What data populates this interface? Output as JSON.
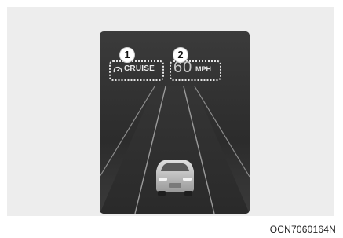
{
  "hud": {
    "cruise": {
      "icon": "speedometer-icon",
      "label": "CRUISE",
      "callout": "1"
    },
    "speed": {
      "value": "60",
      "unit": "MPH",
      "callout": "2"
    }
  },
  "figure_code": "OCN7060164N",
  "colors": {
    "display_background": "#333333",
    "hud_text": "#e8e8e8",
    "frame_background": "#ededed"
  }
}
